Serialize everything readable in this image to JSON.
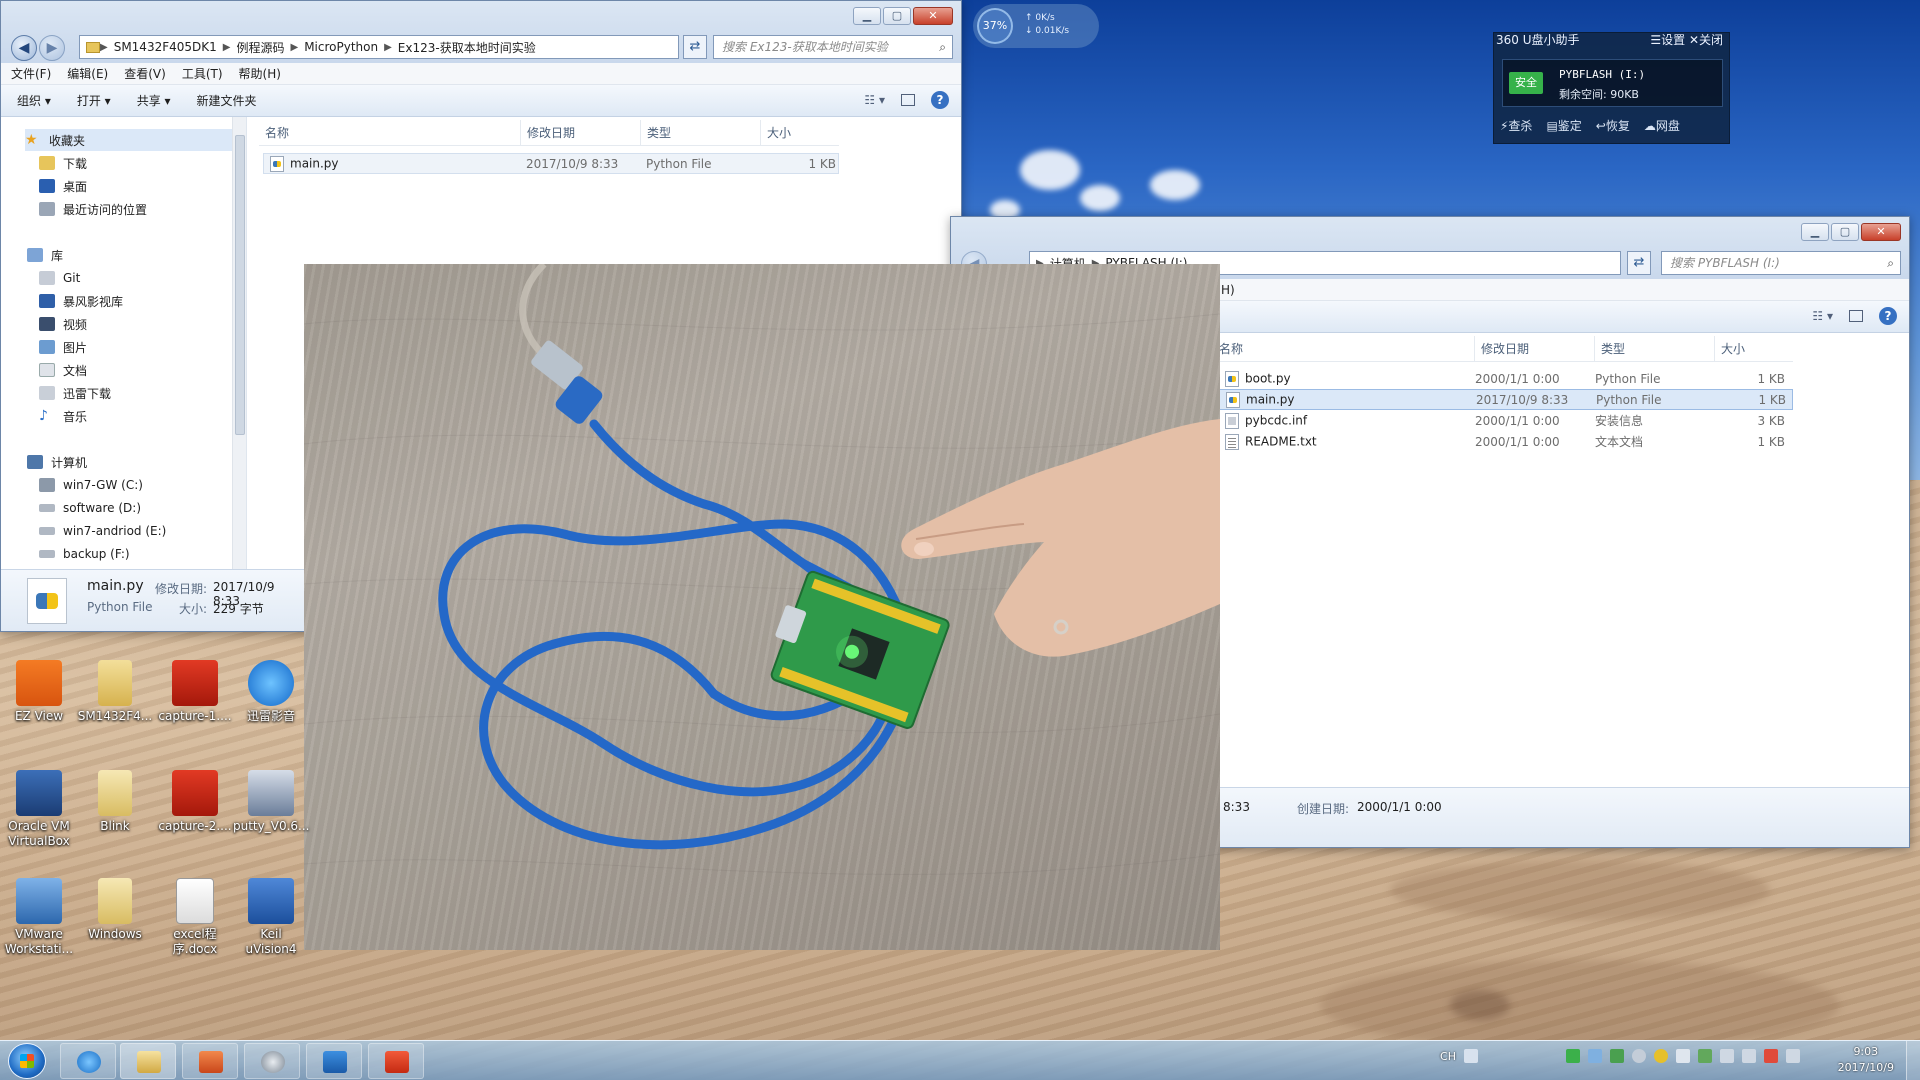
{
  "colors": {
    "accent": "#3670c2",
    "selection": "#dbe8f8",
    "taskbar": "#7e9cc0",
    "pcb": "#2f9a4a",
    "cable": "#2468c8",
    "led": "#6cff7a"
  },
  "left_window": {
    "address": [
      "SM1432F405DK1",
      "例程源码",
      "MicroPython",
      "Ex123-获取本地时间实验"
    ],
    "search_placeholder": "搜索 Ex123-获取本地时间实验",
    "menu": [
      "文件(F)",
      "编辑(E)",
      "查看(V)",
      "工具(T)",
      "帮助(H)"
    ],
    "toolbar": {
      "organize": "组织 ▾",
      "open": "打开 ▾",
      "share": "共享 ▾",
      "new_folder": "新建文件夹"
    },
    "columns": [
      "名称",
      "修改日期",
      "类型",
      "大小"
    ],
    "files": [
      {
        "name": "main.py",
        "date": "2017/10/9 8:33",
        "type": "Python File",
        "size": "1 KB"
      }
    ],
    "nav": {
      "favorites_header": "收藏夹",
      "favorites": [
        "下载",
        "桌面",
        "最近访问的位置"
      ],
      "libraries_header": "库",
      "libraries": [
        "Git",
        "暴风影视库",
        "视频",
        "图片",
        "文档",
        "迅雷下载",
        "音乐"
      ],
      "computer_header": "计算机",
      "drives": [
        "win7-GW (C:)",
        "software (D:)",
        "win7-andriod (E:)",
        "backup (F:)"
      ]
    },
    "details": {
      "name": "main.py",
      "type": "Python File",
      "modified_label": "修改日期:",
      "modified": "2017/10/9 8:33",
      "size_label": "大小:",
      "size": "229 字节"
    }
  },
  "right_window": {
    "address": [
      "计算机",
      "PYBFLASH (I:)"
    ],
    "search_placeholder": "搜索 PYBFLASH (I:)",
    "menu_fragment": "H)",
    "columns": [
      "名称",
      "修改日期",
      "类型",
      "大小"
    ],
    "files": [
      {
        "name": "boot.py",
        "date": "2000/1/1 0:00",
        "type": "Python File",
        "size": "1 KB",
        "icon": "py"
      },
      {
        "name": "main.py",
        "date": "2017/10/9 8:33",
        "type": "Python File",
        "size": "1 KB",
        "icon": "py"
      },
      {
        "name": "pybcdc.inf",
        "date": "2000/1/1 0:00",
        "type": "安装信息",
        "size": "3 KB",
        "icon": "inf"
      },
      {
        "name": "README.txt",
        "date": "2000/1/1 0:00",
        "type": "文本文档",
        "size": "1 KB",
        "icon": "txt"
      }
    ],
    "details": {
      "time_fragment": "8:33",
      "created_label": "创建日期:",
      "created": "2000/1/1 0:00"
    }
  },
  "u360": {
    "title": "360 U盘小助手",
    "settings": "☰设置",
    "close": "✕关闭",
    "safe_badge": "安全",
    "drive_name": "PYBFLASH (I:)",
    "free_space": "剩余空间: 90KB",
    "actions": [
      "⚡查杀",
      "▤鉴定",
      "↩恢复",
      "☁网盘"
    ]
  },
  "net_widget": {
    "percent": "37%",
    "up": "↑ 0K/s",
    "down": "↓ 0.01K/s"
  },
  "desktop_icons": [
    {
      "label": "EZ View"
    },
    {
      "label": "SM1432F4..."
    },
    {
      "label": "capture-1...."
    },
    {
      "label": "迅雷影音"
    },
    {
      "label": "Oracle VM VirtualBox"
    },
    {
      "label": "Blink"
    },
    {
      "label": "capture-2...."
    },
    {
      "label": "putty_V0.6..."
    },
    {
      "label": "VMware Workstati..."
    },
    {
      "label": "Windows"
    },
    {
      "label": "excel程序.docx"
    },
    {
      "label": "Keil uVision4"
    }
  ],
  "taskbar": {
    "lang": "CH",
    "time": "9:03",
    "date": "2017/10/9"
  }
}
